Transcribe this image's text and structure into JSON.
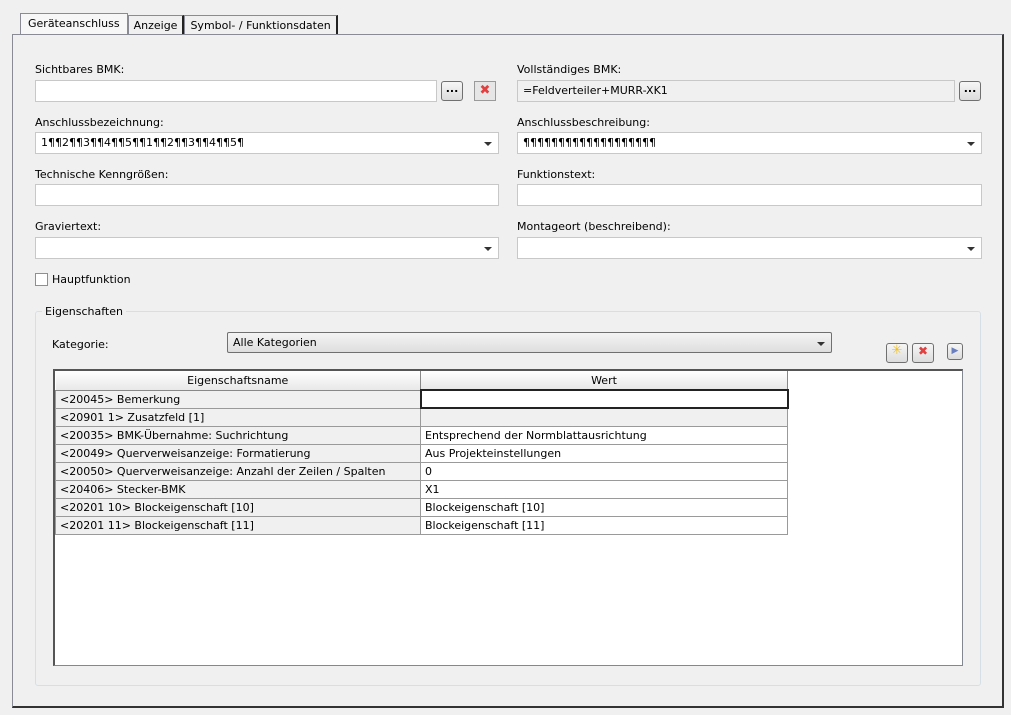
{
  "tabs": [
    "Geräteanschluss",
    "Anzeige",
    "Symbol- / Funktionsdaten"
  ],
  "fields": {
    "sichtbares_bmk": {
      "label": "Sichtbares BMK:",
      "value": ""
    },
    "vollstaendiges_bmk": {
      "label": "Vollständiges BMK:",
      "value": "=Feldverteiler+MURR-XK1"
    },
    "anschlussbezeichnung": {
      "label": "Anschlussbezeichnung:",
      "value": "1¶¶2¶¶3¶¶4¶¶5¶¶1¶¶2¶¶3¶¶4¶¶5¶"
    },
    "anschlussbeschreibung": {
      "label": "Anschlussbeschreibung:",
      "value": "¶¶¶¶¶¶¶¶¶¶¶¶¶¶¶¶¶¶¶"
    },
    "technische_kenngroessen": {
      "label": "Technische Kenngrößen:",
      "value": ""
    },
    "funktionstext": {
      "label": "Funktionstext:",
      "value": ""
    },
    "graviertext": {
      "label": "Graviertext:",
      "value": ""
    },
    "montageort": {
      "label": "Montageort (beschreibend):",
      "value": ""
    }
  },
  "ellipsis": "...",
  "delete_glyph": "✖",
  "hauptfunktion": {
    "label": "Hauptfunktion",
    "checked": false
  },
  "eigenschaften": {
    "title": "Eigenschaften",
    "kategorie_label": "Kategorie:",
    "kategorie_value": "Alle Kategorien",
    "columns": [
      "Eigenschaftsname",
      "Wert"
    ],
    "rows": [
      [
        "<20045> Bemerkung",
        ""
      ],
      [
        "<20901 1> Zusatzfeld [1]",
        ""
      ],
      [
        "<20035> BMK-Übernahme: Suchrichtung",
        "Entsprechend der Normblattausrichtung"
      ],
      [
        "<20049> Querverweisanzeige: Formatierung",
        "Aus Projekteinstellungen"
      ],
      [
        "<20050> Querverweisanzeige: Anzahl der Zeilen / Spalten",
        "0"
      ],
      [
        "<20406> Stecker-BMK",
        "X1"
      ],
      [
        "<20201 10> Blockeigenschaft [10]",
        "Blockeigenschaft [10]"
      ],
      [
        "<20201 11> Blockeigenschaft [11]",
        "Blockeigenschaft [11]"
      ]
    ]
  }
}
